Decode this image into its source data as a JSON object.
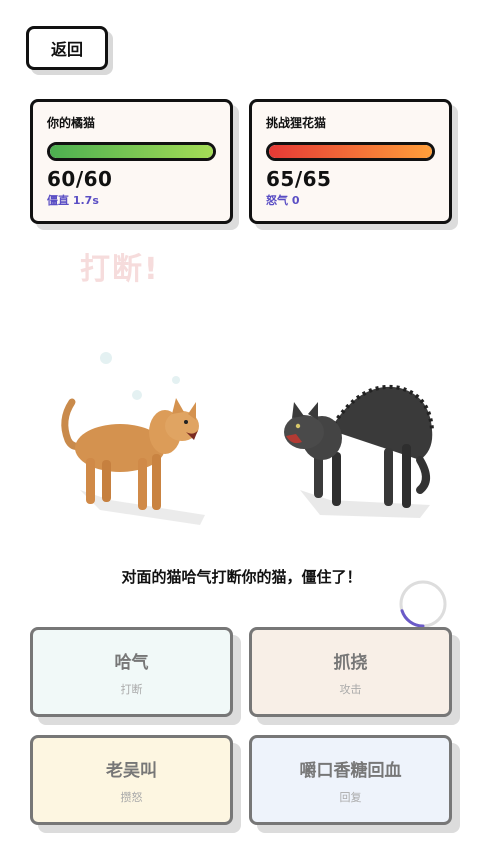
{
  "back_label": "返回",
  "player": {
    "name": "你的橘猫",
    "hp": "60/60",
    "hp_fraction": 1.0,
    "status": "僵直 1.7s"
  },
  "enemy": {
    "name": "挑战狸花猫",
    "hp": "65/65",
    "hp_fraction": 1.0,
    "status": "怒气 0"
  },
  "floating_text": "打断!",
  "message": "对面的猫哈气打断你的猫，僵住了！",
  "timer_fraction": 0.2,
  "actions": [
    {
      "title": "哈气",
      "sub": "打断"
    },
    {
      "title": "抓挠",
      "sub": "攻击"
    },
    {
      "title": "老吴叫",
      "sub": "攒怒"
    },
    {
      "title": "嚼口香糖回血",
      "sub": "回复"
    }
  ],
  "colors": {
    "player_bar": "#8bc34a",
    "enemy_bar": "#f4623a",
    "status": "#5a4ec4",
    "timer": "#6b5ac8"
  },
  "icons": [
    "orange-cat-sprite",
    "tabby-cat-sprite"
  ]
}
